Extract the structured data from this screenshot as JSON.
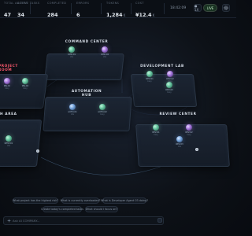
{
  "topbar": {
    "stats": [
      {
        "label": "TOTAL AGENTS",
        "value": "47"
      },
      {
        "label": "ACTIVE TASKS",
        "value": "34"
      },
      {
        "label": "COMPLETED",
        "value": "284"
      },
      {
        "label": "ERRORS",
        "value": "6"
      },
      {
        "label": "TOKENS",
        "value": "1,284",
        "unit": "K"
      },
      {
        "label": "COST",
        "value": "¥12.4",
        "unit": "K"
      }
    ],
    "time": "18:42:09",
    "live_label": "● 1X",
    "speed_label": "LIVE",
    "settings_icon": "gear-icon"
  },
  "rooms": {
    "command": "COMMAND CENTER",
    "project": "PROJECT ROOM",
    "development": "DEVELOPMENT LAB",
    "automation": "AUTOMATION HUB",
    "rest": "H AREA",
    "review": "REVIEW CENTER"
  },
  "agents": {
    "command_a": {
      "name": "CMD-01",
      "status": "idle"
    },
    "command_b": {
      "name": "CMD-02",
      "status": "idle"
    },
    "project_a": {
      "name": "PRJ-01",
      "status": "busy"
    },
    "project_b": {
      "name": "PRJ-02",
      "status": "busy"
    },
    "dev_a": {
      "name": "DEV-01",
      "status": "busy"
    },
    "dev_b": {
      "name": "DEV-02",
      "status": "busy"
    },
    "dev_c": {
      "name": "DEV-03",
      "status": "busy"
    },
    "auto_a": {
      "name": "AUTO-01",
      "status": "idle"
    },
    "auto_b": {
      "name": "AUTO-02",
      "status": "busy"
    },
    "rest_a": {
      "name": "REST-01",
      "status": "idle"
    },
    "review_a": {
      "name": "REV-01",
      "status": "busy"
    },
    "review_b": {
      "name": "REV-02",
      "status": "busy"
    },
    "review_c": {
      "name": "REV-03",
      "status": "idle"
    }
  },
  "suggestions": [
    "What project has the highest risk?",
    "What is currently overloaded?",
    "What is Developer Agent 03 doing?",
    "Create today's completed tasks",
    "What should I focus on?"
  ],
  "input": {
    "placeholder": "Ask AI COMPANY..."
  }
}
